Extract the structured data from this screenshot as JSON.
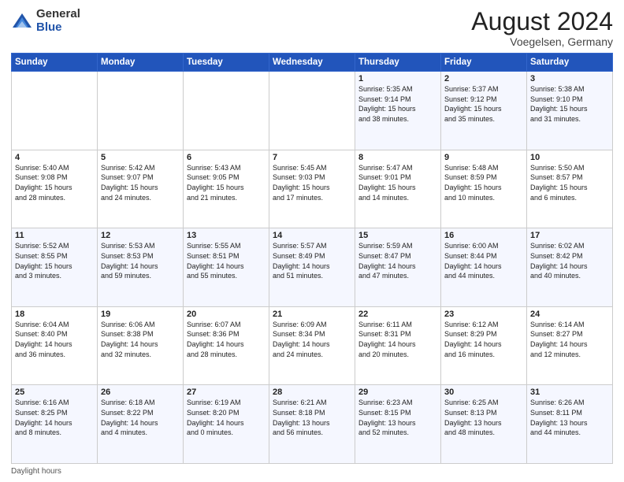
{
  "logo": {
    "general": "General",
    "blue": "Blue"
  },
  "header": {
    "month": "August 2024",
    "location": "Voegelsen, Germany"
  },
  "days_of_week": [
    "Sunday",
    "Monday",
    "Tuesday",
    "Wednesday",
    "Thursday",
    "Friday",
    "Saturday"
  ],
  "weeks": [
    [
      {
        "day": "",
        "info": ""
      },
      {
        "day": "",
        "info": ""
      },
      {
        "day": "",
        "info": ""
      },
      {
        "day": "",
        "info": ""
      },
      {
        "day": "1",
        "info": "Sunrise: 5:35 AM\nSunset: 9:14 PM\nDaylight: 15 hours\nand 38 minutes."
      },
      {
        "day": "2",
        "info": "Sunrise: 5:37 AM\nSunset: 9:12 PM\nDaylight: 15 hours\nand 35 minutes."
      },
      {
        "day": "3",
        "info": "Sunrise: 5:38 AM\nSunset: 9:10 PM\nDaylight: 15 hours\nand 31 minutes."
      }
    ],
    [
      {
        "day": "4",
        "info": "Sunrise: 5:40 AM\nSunset: 9:08 PM\nDaylight: 15 hours\nand 28 minutes."
      },
      {
        "day": "5",
        "info": "Sunrise: 5:42 AM\nSunset: 9:07 PM\nDaylight: 15 hours\nand 24 minutes."
      },
      {
        "day": "6",
        "info": "Sunrise: 5:43 AM\nSunset: 9:05 PM\nDaylight: 15 hours\nand 21 minutes."
      },
      {
        "day": "7",
        "info": "Sunrise: 5:45 AM\nSunset: 9:03 PM\nDaylight: 15 hours\nand 17 minutes."
      },
      {
        "day": "8",
        "info": "Sunrise: 5:47 AM\nSunset: 9:01 PM\nDaylight: 15 hours\nand 14 minutes."
      },
      {
        "day": "9",
        "info": "Sunrise: 5:48 AM\nSunset: 8:59 PM\nDaylight: 15 hours\nand 10 minutes."
      },
      {
        "day": "10",
        "info": "Sunrise: 5:50 AM\nSunset: 8:57 PM\nDaylight: 15 hours\nand 6 minutes."
      }
    ],
    [
      {
        "day": "11",
        "info": "Sunrise: 5:52 AM\nSunset: 8:55 PM\nDaylight: 15 hours\nand 3 minutes."
      },
      {
        "day": "12",
        "info": "Sunrise: 5:53 AM\nSunset: 8:53 PM\nDaylight: 14 hours\nand 59 minutes."
      },
      {
        "day": "13",
        "info": "Sunrise: 5:55 AM\nSunset: 8:51 PM\nDaylight: 14 hours\nand 55 minutes."
      },
      {
        "day": "14",
        "info": "Sunrise: 5:57 AM\nSunset: 8:49 PM\nDaylight: 14 hours\nand 51 minutes."
      },
      {
        "day": "15",
        "info": "Sunrise: 5:59 AM\nSunset: 8:47 PM\nDaylight: 14 hours\nand 47 minutes."
      },
      {
        "day": "16",
        "info": "Sunrise: 6:00 AM\nSunset: 8:44 PM\nDaylight: 14 hours\nand 44 minutes."
      },
      {
        "day": "17",
        "info": "Sunrise: 6:02 AM\nSunset: 8:42 PM\nDaylight: 14 hours\nand 40 minutes."
      }
    ],
    [
      {
        "day": "18",
        "info": "Sunrise: 6:04 AM\nSunset: 8:40 PM\nDaylight: 14 hours\nand 36 minutes."
      },
      {
        "day": "19",
        "info": "Sunrise: 6:06 AM\nSunset: 8:38 PM\nDaylight: 14 hours\nand 32 minutes."
      },
      {
        "day": "20",
        "info": "Sunrise: 6:07 AM\nSunset: 8:36 PM\nDaylight: 14 hours\nand 28 minutes."
      },
      {
        "day": "21",
        "info": "Sunrise: 6:09 AM\nSunset: 8:34 PM\nDaylight: 14 hours\nand 24 minutes."
      },
      {
        "day": "22",
        "info": "Sunrise: 6:11 AM\nSunset: 8:31 PM\nDaylight: 14 hours\nand 20 minutes."
      },
      {
        "day": "23",
        "info": "Sunrise: 6:12 AM\nSunset: 8:29 PM\nDaylight: 14 hours\nand 16 minutes."
      },
      {
        "day": "24",
        "info": "Sunrise: 6:14 AM\nSunset: 8:27 PM\nDaylight: 14 hours\nand 12 minutes."
      }
    ],
    [
      {
        "day": "25",
        "info": "Sunrise: 6:16 AM\nSunset: 8:25 PM\nDaylight: 14 hours\nand 8 minutes."
      },
      {
        "day": "26",
        "info": "Sunrise: 6:18 AM\nSunset: 8:22 PM\nDaylight: 14 hours\nand 4 minutes."
      },
      {
        "day": "27",
        "info": "Sunrise: 6:19 AM\nSunset: 8:20 PM\nDaylight: 14 hours\nand 0 minutes."
      },
      {
        "day": "28",
        "info": "Sunrise: 6:21 AM\nSunset: 8:18 PM\nDaylight: 13 hours\nand 56 minutes."
      },
      {
        "day": "29",
        "info": "Sunrise: 6:23 AM\nSunset: 8:15 PM\nDaylight: 13 hours\nand 52 minutes."
      },
      {
        "day": "30",
        "info": "Sunrise: 6:25 AM\nSunset: 8:13 PM\nDaylight: 13 hours\nand 48 minutes."
      },
      {
        "day": "31",
        "info": "Sunrise: 6:26 AM\nSunset: 8:11 PM\nDaylight: 13 hours\nand 44 minutes."
      }
    ]
  ],
  "footer": {
    "note": "Daylight hours"
  }
}
